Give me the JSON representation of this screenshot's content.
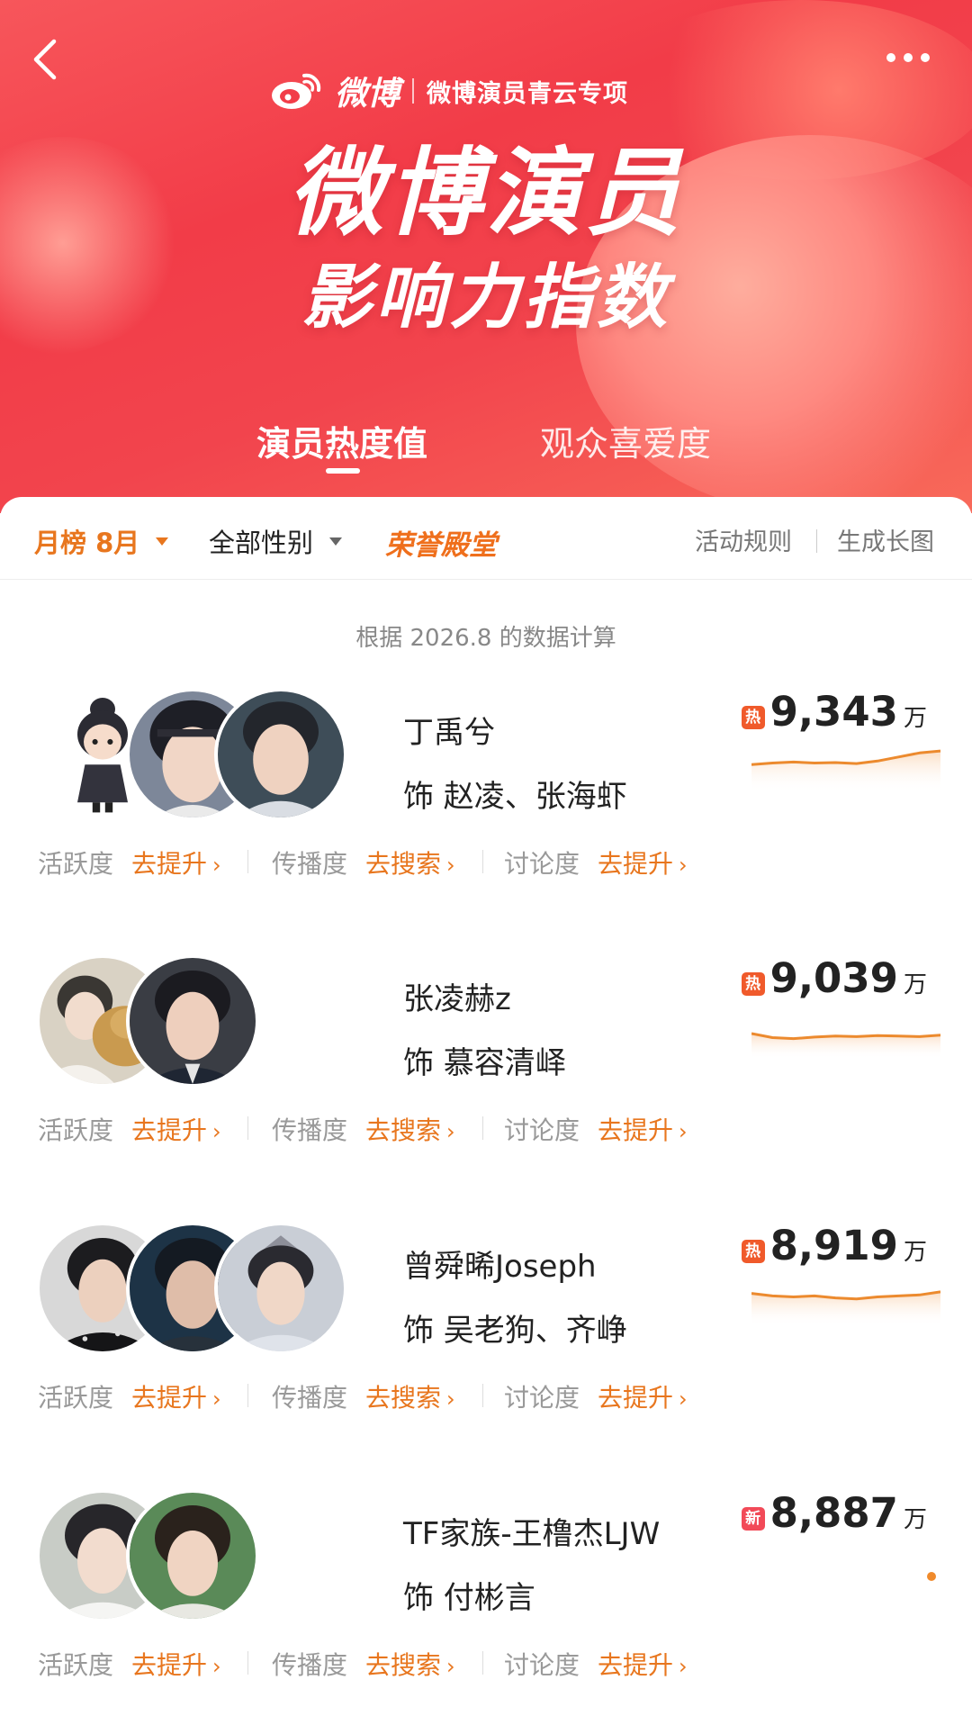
{
  "header": {
    "brand_name": "微博",
    "brand_sub": "微博演员青云专项",
    "title": "微博演员",
    "subtitle": "影响力指数",
    "tabs": [
      {
        "label": "演员热度值",
        "active": true
      },
      {
        "label": "观众喜爱度",
        "active": false
      }
    ]
  },
  "filters": {
    "month": "月榜 8月",
    "gender": "全部性别",
    "honor": "荣誉殿堂",
    "rules": "活动规则",
    "long_image": "生成长图"
  },
  "data_note": "根据 2026.8 的数据计算",
  "metric_labels": {
    "activity": "活跃度",
    "activity_action": "去提升",
    "spread": "传播度",
    "spread_action": "去搜索",
    "discussion": "讨论度",
    "discussion_action": "去提升"
  },
  "entries": [
    {
      "name": "丁禹兮",
      "roles": "饰 赵凌、张海虾",
      "badge": "热",
      "score": "9,343",
      "unit": "万",
      "trend": [
        0.45,
        0.42,
        0.4,
        0.42,
        0.41,
        0.43,
        0.38,
        0.3,
        0.22,
        0.18
      ]
    },
    {
      "name": "张凌赫z",
      "roles": "饰 慕容清峄",
      "badge": "热",
      "score": "9,039",
      "unit": "万",
      "trend": [
        0.5,
        0.58,
        0.6,
        0.57,
        0.55,
        0.56,
        0.54,
        0.55,
        0.56,
        0.53
      ]
    },
    {
      "name": "曾舜晞Joseph",
      "roles": "饰 吴老狗、齐峥",
      "badge": "热",
      "score": "8,919",
      "unit": "万",
      "trend": [
        0.35,
        0.4,
        0.42,
        0.4,
        0.44,
        0.46,
        0.42,
        0.4,
        0.38,
        0.32
      ]
    },
    {
      "name": "TF家族-王橹杰LJW",
      "roles": "饰 付彬言",
      "badge": "新",
      "score": "8,887",
      "unit": "万",
      "trend": []
    }
  ],
  "colors": {
    "accent": "#e8761e",
    "banner": "#f23c48",
    "hot_badge": "#f05a2b",
    "new_badge": "#f24a58"
  },
  "icons": [
    "back-icon",
    "more-icon",
    "weibo-logo-icon",
    "caret-down-icon",
    "chevron-right-icon"
  ]
}
